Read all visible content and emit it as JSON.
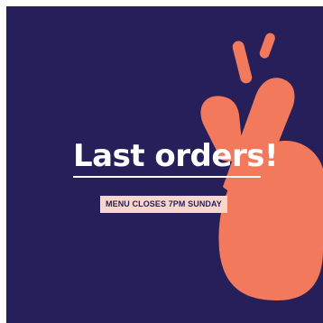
{
  "colors": {
    "background": "#271f5a",
    "accent": "#f2795b",
    "badge_background": "#f8d6cb",
    "text": "#ffffff"
  },
  "promo": {
    "headline": "Last orders!",
    "badge": "MENU CLOSES 7PM SUNDAY"
  },
  "illustration": {
    "icon": "crossed-fingers-icon"
  }
}
